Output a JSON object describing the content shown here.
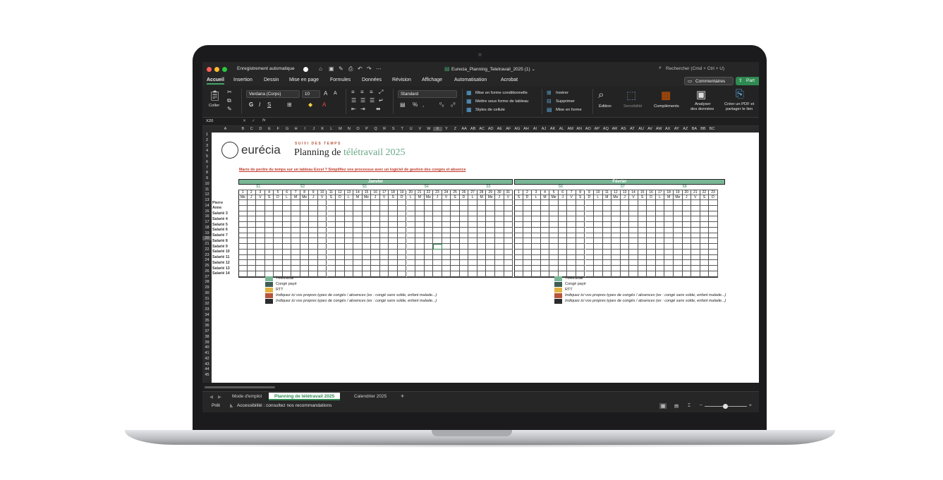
{
  "window": {
    "autosave_label": "Enregistrement automatique",
    "file_name": "Eurecia_Planning_Teletravail_2025 (1) ⌄",
    "search_placeholder": "Rechercher (Cmd + Ctrl + U)"
  },
  "menu": {
    "items": [
      "Accueil",
      "Insertion",
      "Dessin",
      "Mise en page",
      "Formules",
      "Données",
      "Révision",
      "Affichage",
      "Automatisation",
      "Acrobat"
    ],
    "comments_label": "Commentaires",
    "share_label": "Part"
  },
  "ribbon": {
    "paste_label": "Coller",
    "font_name": "Verdana (Corps)",
    "font_size": "10",
    "number_format": "Standard",
    "cond_format": "Mise en forme conditionnelle",
    "table_format": "Mettre sous forme de tableau",
    "cell_styles": "Styles de cellule",
    "insert": "Insérer",
    "delete": "Supprimer",
    "format": "Mise en forme",
    "edit": "Édition",
    "sensitivity": "Sensibilité",
    "addins": "Compléments",
    "analyze_line1": "Analyser",
    "analyze_line2": "des données",
    "pdf_line1": "Créer un PDF et",
    "pdf_line2": "partager le lien"
  },
  "formula_bar": {
    "cell_ref": "X20",
    "fx": "fx"
  },
  "columns": [
    "A",
    "B",
    "C",
    "D",
    "E",
    "F",
    "G",
    "H",
    "I",
    "J",
    "K",
    "L",
    "M",
    "N",
    "O",
    "P",
    "Q",
    "R",
    "S",
    "T",
    "U",
    "V",
    "W",
    "X",
    "Y",
    "Z",
    "AA",
    "AB",
    "AC",
    "AD",
    "AE",
    "AF",
    "AG",
    "AH",
    "AI",
    "AJ",
    "AK",
    "AL",
    "AM",
    "AN",
    "AO",
    "AP",
    "AQ",
    "AR",
    "AS",
    "AT",
    "AU",
    "AV",
    "AW",
    "AX",
    "AY",
    "AZ",
    "BA",
    "BB",
    "BC"
  ],
  "rows": [
    "1",
    "2",
    "3",
    "4",
    "5",
    "6",
    "7",
    "8",
    "9",
    "10",
    "11",
    "12",
    "13",
    "14",
    "15",
    "16",
    "17",
    "18",
    "19",
    "20",
    "21",
    "22",
    "23",
    "24",
    "25",
    "26",
    "27",
    "28",
    "29",
    "30",
    "31",
    "32",
    "33",
    "34",
    "35",
    "36",
    "37",
    "38",
    "39",
    "40",
    "41",
    "42",
    "43",
    "44",
    "45"
  ],
  "sheet": {
    "logo_text": "eurécia",
    "subtitle": "SUIVI DES TEMPS",
    "title_prefix": "Planning de ",
    "title_accent": "télétravail 2025",
    "promo": "Marre de perdre du temps sur un tableau Excel ? Simplifiez vos processus avec un logiciel de gestion des congés et absence",
    "months": [
      "Janvier",
      "Février"
    ],
    "weeks_jan": [
      "S1",
      "S2",
      "S3",
      "S4",
      "S5"
    ],
    "weeks_feb": [
      "S6",
      "S7",
      "S8"
    ],
    "days_jan": [
      "1",
      "2",
      "3",
      "4",
      "5",
      "6",
      "7",
      "8",
      "9",
      "10",
      "11",
      "12",
      "13",
      "14",
      "15",
      "16",
      "17",
      "18",
      "19",
      "20",
      "21",
      "22",
      "23",
      "24",
      "25",
      "26",
      "27",
      "28",
      "29",
      "30",
      "31"
    ],
    "dow_jan": [
      "Me",
      "J",
      "V",
      "S",
      "D",
      "L",
      "M",
      "Me",
      "J",
      "V",
      "S",
      "D",
      "L",
      "M",
      "Me",
      "J",
      "V",
      "S",
      "D",
      "L",
      "M",
      "Me",
      "J",
      "V",
      "S",
      "D",
      "L",
      "M",
      "Me",
      "J",
      "V"
    ],
    "days_feb": [
      "1",
      "2",
      "3",
      "4",
      "5",
      "6",
      "7",
      "8",
      "9",
      "10",
      "11",
      "12",
      "13",
      "14",
      "15",
      "16",
      "17",
      "18",
      "19",
      "20",
      "21",
      "22",
      "23"
    ],
    "dow_feb": [
      "S",
      "D",
      "L",
      "M",
      "Me",
      "J",
      "V",
      "S",
      "D",
      "L",
      "M",
      "Me",
      "J",
      "V",
      "S",
      "D",
      "L",
      "M",
      "Me",
      "J",
      "V",
      "S",
      "D"
    ],
    "employees": [
      "Pierre",
      "Anne",
      "Salarié 3",
      "Salarié 4",
      "Salarié 5",
      "Salarié 6",
      "Salarié 7",
      "Salarié 8",
      "Salarié 9",
      "Salarié 10",
      "Salarié 11",
      "Salarié 12",
      "Salarié 13",
      "Salarié 14"
    ],
    "legend": [
      {
        "label": "Télétravail",
        "color": "#7ab797",
        "italic": false
      },
      {
        "label": "Congé payé",
        "color": "#3f5f55",
        "italic": false
      },
      {
        "label": "RTT",
        "color": "#e3b341",
        "italic": false
      },
      {
        "label": "Indiquez ici vos propres types de congés / absences (ex : congé sans solde, enfant malade...)",
        "color": "#b5553b",
        "italic": true
      },
      {
        "label": "Indiquez ici vos propres types de congés / absences (ex : congé sans solde, enfant malade...)",
        "color": "#2b2b2b",
        "italic": true
      }
    ]
  },
  "tabs": [
    "Mode d'emploi",
    "Planning de télétravail 2025",
    "Calendrier 2025"
  ],
  "add_tab": "+",
  "status": {
    "ready": "Prêt",
    "accessibility": "Accessibilité : consultez nos recommandations"
  }
}
